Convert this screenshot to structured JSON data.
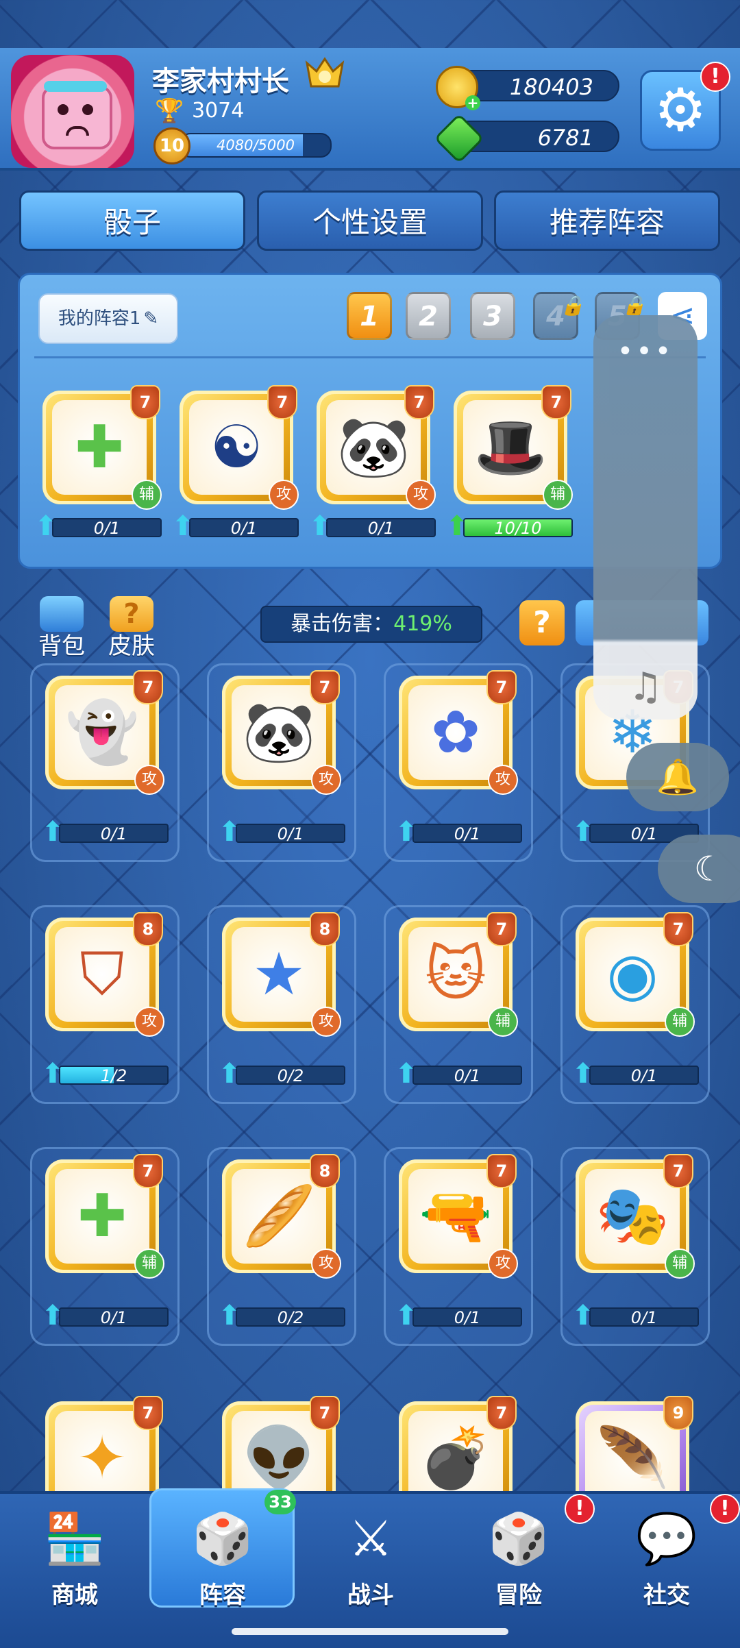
{
  "player": {
    "name": "李家村村长",
    "trophies": "3074",
    "level": "10",
    "xp_text": "4080/5000",
    "xp_fraction": 0.816
  },
  "currency": {
    "coins": "180403",
    "gems": "6781"
  },
  "settings": {
    "alert": "!"
  },
  "tabs": [
    {
      "label": "骰子"
    },
    {
      "label": "个性设置"
    },
    {
      "label": "推荐阵容"
    }
  ],
  "lineup": {
    "name": "我的阵容1",
    "slots": [
      "1",
      "2",
      "3",
      "4",
      "5"
    ],
    "cards": [
      {
        "icon": "plus-icon",
        "glyph": "✚",
        "color": "#5ac24a",
        "level": "7",
        "type": "辅",
        "progress": "0/1",
        "fill": 0,
        "type_kind": "sup"
      },
      {
        "icon": "yin-yang-icon",
        "glyph": "☯",
        "color": "#1e3e86",
        "level": "7",
        "type": "攻",
        "progress": "0/1",
        "fill": 0,
        "type_kind": "atk"
      },
      {
        "icon": "panda-icon",
        "glyph": "🐼",
        "color": "#333333",
        "level": "7",
        "type": "攻",
        "progress": "0/1",
        "fill": 0,
        "type_kind": "atk"
      },
      {
        "icon": "magic-hat-icon",
        "glyph": "🎩",
        "color": "#6a4bd1",
        "level": "7",
        "type": "辅",
        "progress": "10/10",
        "fill": 1,
        "type_kind": "sup"
      }
    ]
  },
  "middle": {
    "bag_label": "背包",
    "skin_label": "皮肤",
    "crit_label": "暴击伤害：",
    "crit_value": "419%",
    "help": "?"
  },
  "grid": [
    {
      "icon": "ghost-icon",
      "glyph": "👻",
      "color": "#8e4fe0",
      "level": "7",
      "type": "攻",
      "type_kind": "atk",
      "progress": "0/1",
      "fill": 0
    },
    {
      "icon": "panda-icon",
      "glyph": "🐼",
      "color": "#333333",
      "level": "7",
      "type": "攻",
      "type_kind": "atk",
      "progress": "0/1",
      "fill": 0
    },
    {
      "icon": "flower-icon",
      "glyph": "✿",
      "color": "#4a6fe0",
      "level": "7",
      "type": "攻",
      "type_kind": "atk",
      "progress": "0/1",
      "fill": 0
    },
    {
      "icon": "snow-icon",
      "glyph": "❄",
      "color": "#3a9be0",
      "level": "7",
      "type": "",
      "type_kind": "atk",
      "progress": "0/1",
      "fill": 0
    },
    {
      "icon": "shield-icon",
      "glyph": "⛉",
      "color": "#c8502a",
      "level": "8",
      "type": "攻",
      "type_kind": "atk",
      "progress": "1/2",
      "fill": 0.5
    },
    {
      "icon": "star-icon",
      "glyph": "★",
      "color": "#3f7fe6",
      "level": "8",
      "type": "攻",
      "type_kind": "atk",
      "progress": "0/2",
      "fill": 0
    },
    {
      "icon": "lucky-cat-icon",
      "glyph": "🐱",
      "color": "#e06a2a",
      "level": "7",
      "type": "辅",
      "type_kind": "sup",
      "progress": "0/1",
      "fill": 0
    },
    {
      "icon": "signal-icon",
      "glyph": "◉",
      "color": "#2a9fe0",
      "level": "7",
      "type": "辅",
      "type_kind": "sup",
      "progress": "0/1",
      "fill": 0
    },
    {
      "icon": "plus-icon",
      "glyph": "✚",
      "color": "#5ac24a",
      "level": "7",
      "type": "辅",
      "type_kind": "sup",
      "progress": "0/1",
      "fill": 0
    },
    {
      "icon": "bread-icon",
      "glyph": "🥖",
      "color": "#e0822a",
      "level": "8",
      "type": "攻",
      "type_kind": "atk",
      "progress": "0/2",
      "fill": 0
    },
    {
      "icon": "pistol-icon",
      "glyph": "🔫",
      "color": "#e0562a",
      "level": "7",
      "type": "攻",
      "type_kind": "atk",
      "progress": "0/1",
      "fill": 0
    },
    {
      "icon": "mask-icon",
      "glyph": "🎭",
      "color": "#e0562a",
      "level": "7",
      "type": "辅",
      "type_kind": "sup",
      "progress": "0/1",
      "fill": 0
    },
    {
      "icon": "sparkle-icon",
      "glyph": "✦",
      "color": "#f2a21f",
      "level": "7"
    },
    {
      "icon": "alien-icon",
      "glyph": "👽",
      "color": "#5a4bd1",
      "level": "7"
    },
    {
      "icon": "bomb-icon",
      "glyph": "💣",
      "color": "#5a4bd1",
      "level": "7"
    },
    {
      "icon": "feather-icon",
      "glyph": "🪶",
      "color": "#9a3fe0",
      "level": "9",
      "purple": true
    }
  ],
  "overlay": {
    "dots": "•••",
    "music": "♫",
    "bell": "🔔",
    "moon": "☾"
  },
  "nav": [
    {
      "label": "商城",
      "glyph": "🏪"
    },
    {
      "label": "阵容",
      "glyph": "🎲",
      "badge": "33"
    },
    {
      "label": "战斗",
      "glyph": "⚔"
    },
    {
      "label": "冒险",
      "glyph": "🎲",
      "alert": "!"
    },
    {
      "label": "社交",
      "glyph": "💬",
      "alert": "!"
    }
  ]
}
